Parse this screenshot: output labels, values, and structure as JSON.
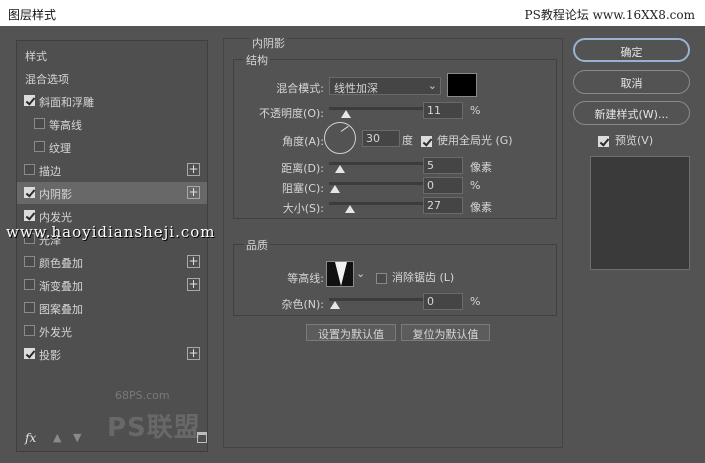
{
  "titlebar": {
    "title": "图层样式",
    "watermark": "PS教程论坛 www.16XX8.com"
  },
  "left": {
    "items": [
      {
        "label": "样式",
        "checkbox": false,
        "checked": false,
        "plus": false,
        "selected": false,
        "indent": false
      },
      {
        "label": "混合选项",
        "checkbox": false,
        "checked": false,
        "plus": false,
        "selected": false,
        "indent": false
      },
      {
        "label": "斜面和浮雕",
        "checkbox": true,
        "checked": true,
        "plus": false,
        "selected": false,
        "indent": false
      },
      {
        "label": "等高线",
        "checkbox": true,
        "checked": false,
        "plus": false,
        "selected": false,
        "indent": true
      },
      {
        "label": "纹理",
        "checkbox": true,
        "checked": false,
        "plus": false,
        "selected": false,
        "indent": true
      },
      {
        "label": "描边",
        "checkbox": true,
        "checked": false,
        "plus": true,
        "selected": false,
        "indent": false
      },
      {
        "label": "内阴影",
        "checkbox": true,
        "checked": true,
        "plus": true,
        "selected": true,
        "indent": false
      },
      {
        "label": "内发光",
        "checkbox": true,
        "checked": true,
        "plus": false,
        "selected": false,
        "indent": false
      },
      {
        "label": "光泽",
        "checkbox": true,
        "checked": false,
        "plus": false,
        "selected": false,
        "indent": false
      },
      {
        "label": "颜色叠加",
        "checkbox": true,
        "checked": false,
        "plus": true,
        "selected": false,
        "indent": false
      },
      {
        "label": "渐变叠加",
        "checkbox": true,
        "checked": false,
        "plus": true,
        "selected": false,
        "indent": false
      },
      {
        "label": "图案叠加",
        "checkbox": true,
        "checked": false,
        "plus": false,
        "selected": false,
        "indent": false
      },
      {
        "label": "外发光",
        "checkbox": true,
        "checked": false,
        "plus": false,
        "selected": false,
        "indent": false
      },
      {
        "label": "投影",
        "checkbox": true,
        "checked": true,
        "plus": true,
        "selected": false,
        "indent": false
      }
    ],
    "footer": {
      "fx": "fx",
      "up": "▲",
      "down": "▼"
    },
    "logo": {
      "site": "68PS.com",
      "brand": "PS联盟"
    }
  },
  "panel": {
    "section_title": "内阴影",
    "structure": {
      "title": "结构",
      "blend_mode_label": "混合模式:",
      "blend_mode_value": "线性加深",
      "swatch_color": "#000000",
      "opacity_label": "不透明度(O):",
      "opacity_value": "11",
      "opacity_unit": "%",
      "opacity_level": 0.11,
      "angle_label": "角度(A):",
      "angle_value": "30",
      "angle_unit": "度",
      "global_light_label": "使用全局光 (G)",
      "global_light_checked": true,
      "distance_label": "距离(D):",
      "distance_value": "5",
      "distance_unit": "像素",
      "distance_level": 0.05,
      "choke_label": "阻塞(C):",
      "choke_value": "0",
      "choke_unit": "%",
      "choke_level": 0,
      "size_label": "大小(S):",
      "size_value": "27",
      "size_unit": "像素",
      "size_level": 0.15
    },
    "quality": {
      "title": "品质",
      "contour_label": "等高线:",
      "antialias_label": "消除锯齿 (L)",
      "antialias_checked": false,
      "noise_label": "杂色(N):",
      "noise_value": "0",
      "noise_unit": "%",
      "noise_level": 0
    },
    "set_default": "设置为默认值",
    "reset_default": "复位为默认值"
  },
  "right": {
    "ok": "确定",
    "cancel": "取消",
    "new_style": "新建样式(W)...",
    "preview_label": "预览(V)",
    "preview_checked": true
  },
  "overlay": {
    "watermark": "www.haoyidiansheji.com"
  },
  "colors": {
    "accent": "#9ab2d2",
    "background": "#535353"
  }
}
